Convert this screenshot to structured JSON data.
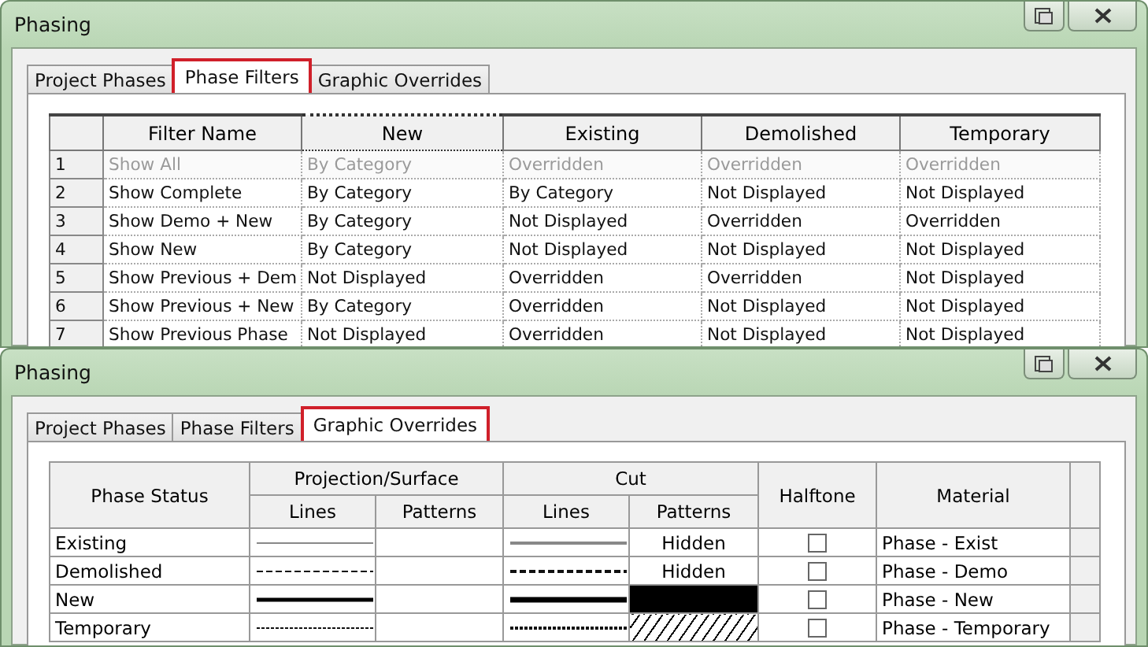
{
  "filters_window": {
    "title": "Phasing",
    "tabs": [
      {
        "label": "Project Phases",
        "selected": false
      },
      {
        "label": "Phase Filters",
        "selected": true
      },
      {
        "label": "Graphic Overrides",
        "selected": false
      }
    ],
    "columns": [
      "Filter Name",
      "New",
      "Existing",
      "Demolished",
      "Temporary"
    ],
    "rows": [
      {
        "number": "1",
        "disabled": true,
        "cells": [
          "Show All",
          "By Category",
          "Overridden",
          "Overridden",
          "Overridden"
        ]
      },
      {
        "number": "2",
        "disabled": false,
        "cells": [
          "Show Complete",
          "By Category",
          "By Category",
          "Not Displayed",
          "Not Displayed"
        ]
      },
      {
        "number": "3",
        "disabled": false,
        "cells": [
          "Show Demo + New",
          "By Category",
          "Not Displayed",
          "Overridden",
          "Overridden"
        ]
      },
      {
        "number": "4",
        "disabled": false,
        "cells": [
          "Show New",
          "By Category",
          "Not Displayed",
          "Not Displayed",
          "Not Displayed"
        ]
      },
      {
        "number": "5",
        "disabled": false,
        "cells": [
          "Show Previous + Dem",
          "Not Displayed",
          "Overridden",
          "Overridden",
          "Not Displayed"
        ]
      },
      {
        "number": "6",
        "disabled": false,
        "cells": [
          "Show Previous + New",
          "By Category",
          "Overridden",
          "Not Displayed",
          "Not Displayed"
        ]
      },
      {
        "number": "7",
        "disabled": false,
        "cells": [
          "Show Previous Phase",
          "Not Displayed",
          "Overridden",
          "Not Displayed",
          "Not Displayed"
        ]
      }
    ]
  },
  "overrides_window": {
    "title": "Phasing",
    "tabs": [
      {
        "label": "Project Phases",
        "selected": false
      },
      {
        "label": "Phase Filters",
        "selected": false
      },
      {
        "label": "Graphic Overrides",
        "selected": true
      }
    ],
    "header": {
      "phase_status": "Phase Status",
      "projection": "Projection/Surface",
      "cut": "Cut",
      "halftone": "Halftone",
      "material": "Material",
      "lines": "Lines",
      "patterns": "Patterns",
      "cut_lines": "Lines",
      "cut_patterns": "Patterns"
    },
    "rows": [
      {
        "status": "Existing",
        "projection_lines": {
          "kind": "solid"
        },
        "cut_lines": {
          "kind": "solid"
        },
        "cut_pattern": {
          "kind": "text",
          "text": "Hidden"
        },
        "halftone": false,
        "material": "Phase - Exist"
      },
      {
        "status": "Demolished",
        "projection_lines": {
          "kind": "dashed"
        },
        "cut_lines": {
          "kind": "dashed"
        },
        "cut_pattern": {
          "kind": "text",
          "text": "Hidden"
        },
        "halftone": false,
        "material": "Phase - Demo"
      },
      {
        "status": "New",
        "projection_lines": {
          "kind": "thick"
        },
        "cut_lines": {
          "kind": "thick"
        },
        "cut_pattern": {
          "kind": "solid"
        },
        "halftone": false,
        "material": "Phase - New"
      },
      {
        "status": "Temporary",
        "projection_lines": {
          "kind": "dotted"
        },
        "cut_lines": {
          "kind": "dotted"
        },
        "cut_pattern": {
          "kind": "hatch"
        },
        "halftone": false,
        "material": "Phase - Temporary"
      }
    ]
  }
}
